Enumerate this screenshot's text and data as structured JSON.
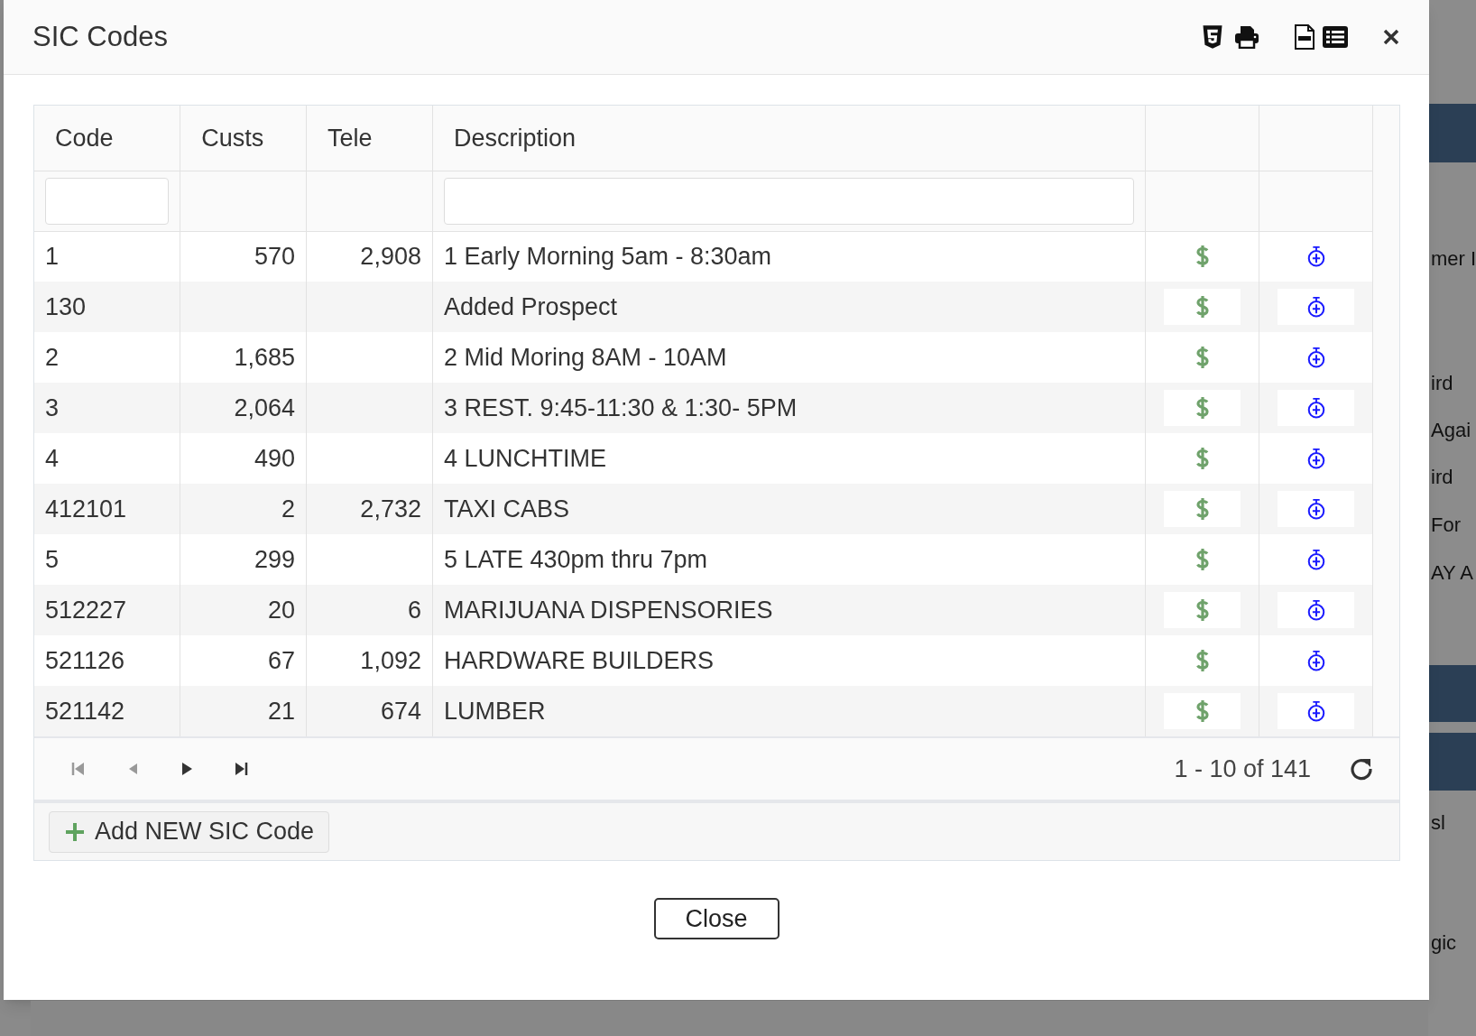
{
  "dialog": {
    "title": "SIC Codes"
  },
  "table": {
    "columns": [
      {
        "label": "Code",
        "filter": true
      },
      {
        "label": "Custs",
        "filter": false
      },
      {
        "label": "Tele",
        "filter": false
      },
      {
        "label": "Description",
        "filter": true
      }
    ],
    "rows": [
      {
        "code": "1",
        "custs": "570",
        "tele": "2,908",
        "description": "1 Early Morning 5am - 8:30am"
      },
      {
        "code": "130",
        "description": "Added Prospect"
      },
      {
        "code": "2",
        "custs": "1,685",
        "description": "2 Mid Moring 8AM - 10AM"
      },
      {
        "code": "3",
        "custs": "2,064",
        "description": "3 REST. 9:45-11:30 & 1:30- 5PM"
      },
      {
        "code": "4",
        "custs": "490",
        "description": "4 LUNCHTIME"
      },
      {
        "code": "412101",
        "custs": "2",
        "tele": "2,732",
        "description": "TAXI CABS"
      },
      {
        "code": "5",
        "custs": "299",
        "description": "5 LATE 430pm thru 7pm"
      },
      {
        "code": "512227",
        "custs": "20",
        "tele": "6",
        "description": "MARIJUANA DISPENSORIES"
      },
      {
        "code": "521126",
        "custs": "67",
        "tele": "1,092",
        "description": "HARDWARE BUILDERS"
      },
      {
        "code": "521142",
        "custs": "21",
        "tele": "674",
        "description": "LUMBER"
      }
    ]
  },
  "pager": {
    "buttons": [
      {
        "kind": "first",
        "disabled": true
      },
      {
        "kind": "prev",
        "disabled": true
      },
      {
        "kind": "next",
        "disabled": false
      },
      {
        "kind": "last",
        "disabled": false
      }
    ],
    "range": "1 - 10 of 141"
  },
  "add_button": {
    "label": "Add NEW SIC Code"
  },
  "close_button": {
    "label": "Close"
  },
  "background": {
    "fragments": [
      "mer I",
      "ird",
      "Agai",
      "ird",
      "For",
      "AY A",
      "sl",
      "gic"
    ]
  }
}
